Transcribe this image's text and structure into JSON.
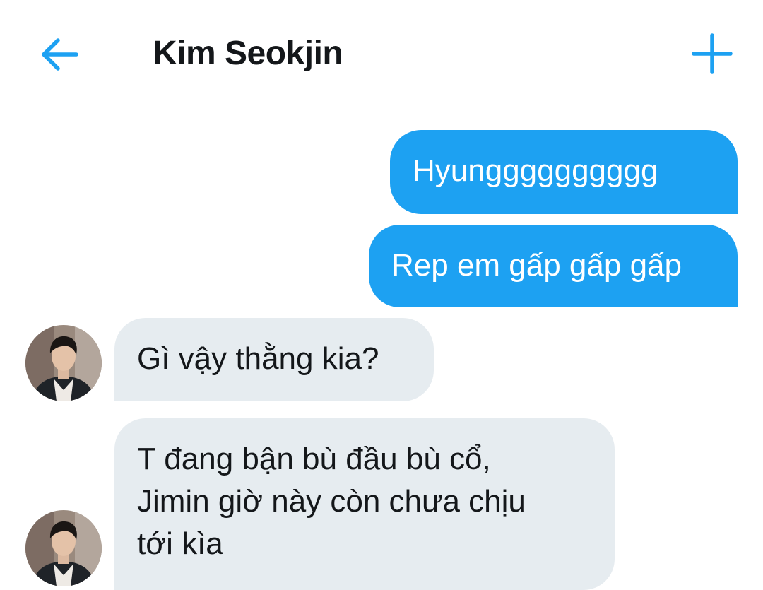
{
  "header": {
    "title": "Kim Seokjin",
    "back_icon": "arrow-left-icon",
    "new_icon": "plus-icon",
    "accent_color": "#1da1f2"
  },
  "conversation": {
    "messages": [
      {
        "direction": "sent",
        "text": "Hyungggggggggg"
      },
      {
        "direction": "sent",
        "text": "Rep em gấp gấp gấp"
      },
      {
        "direction": "received",
        "text": "Gì vậy thằng kia?"
      },
      {
        "direction": "received",
        "lines": [
          "T đang bận bù đầu bù cổ,",
          "Jimin giờ này còn chưa chịu",
          "tới kìa"
        ]
      }
    ],
    "sent_bubble_color": "#1da1f2",
    "received_bubble_color": "#e6ecf0"
  }
}
